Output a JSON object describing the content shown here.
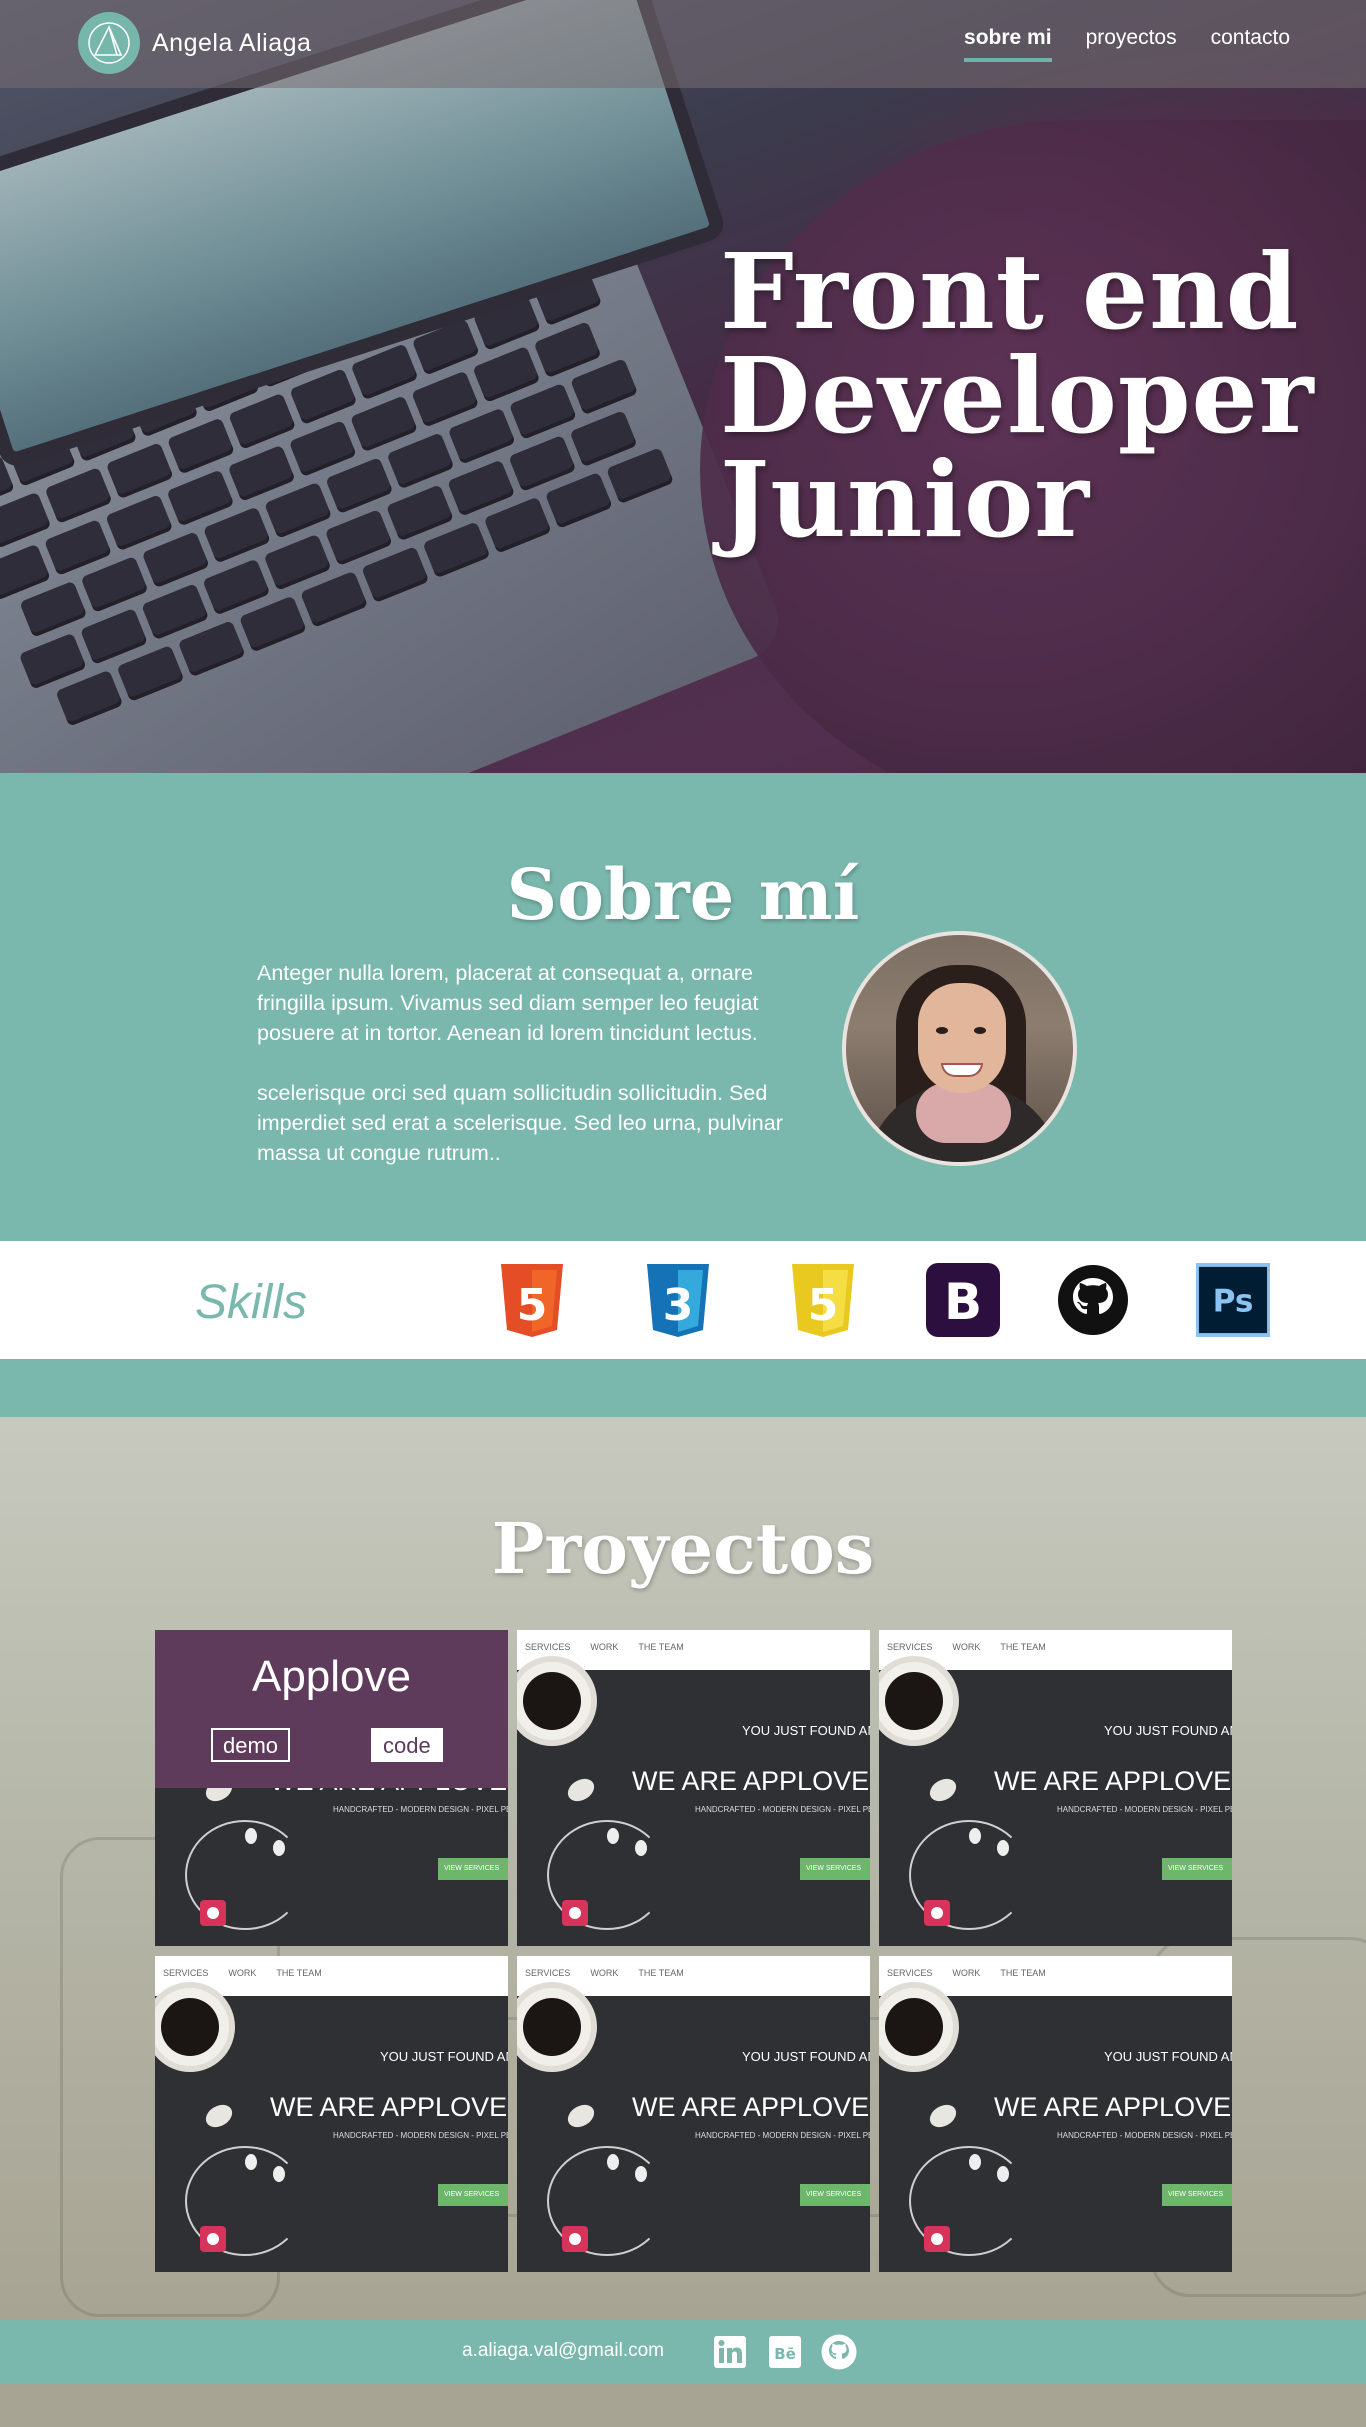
{
  "header": {
    "brand_name": "Angela Aliaga",
    "nav": [
      {
        "label": "sobre mi",
        "active": true
      },
      {
        "label": "proyectos",
        "active": false
      },
      {
        "label": "contacto",
        "active": false
      }
    ]
  },
  "hero": {
    "title_lines": [
      "Front end",
      "Developer",
      "Junior"
    ]
  },
  "about": {
    "title": "Sobre mí",
    "paragraph_1": "Anteger nulla lorem, placerat at consequat a, ornare fringilla ipsum. Vivamus sed diam semper leo feugiat posuere at in tortor. Aenean id lorem tincidunt lectus.",
    "paragraph_2": "scelerisque orci sed quam sollicitudin sollicitudin. Sed imperdiet sed erat a scelerisque. Sed leo urna, pulvinar massa ut congue rutrum..",
    "avatar_icon": "profile-photo"
  },
  "skills": {
    "title": "Skills",
    "items": [
      {
        "icon": "html5-icon",
        "label": "5",
        "color": "#e44d26"
      },
      {
        "icon": "css3-icon",
        "label": "3",
        "color": "#1572b6"
      },
      {
        "icon": "javascript-icon",
        "label": "5",
        "color": "#f0db4f"
      },
      {
        "icon": "bootstrap-icon",
        "label": "B",
        "color": "#2c0f3f"
      },
      {
        "icon": "github-icon",
        "label": "",
        "color": "#111111"
      },
      {
        "icon": "photoshop-icon",
        "label": "Ps",
        "color": "#001d34"
      }
    ]
  },
  "projects": {
    "title": "Proyectos",
    "thumb_nav": [
      "SERVICES",
      "WORK",
      "THE TEAM"
    ],
    "thumb_sub": "YOU JUST FOUND AN U",
    "thumb_headline": "WE ARE APPLOVE",
    "thumb_small": "HANDCRAFTED - MODERN DESIGN - PIXEL PE",
    "thumb_button": "VIEW SERVICES",
    "hover_card": {
      "title": "Applove",
      "demo_label": "demo",
      "code_label": "code"
    }
  },
  "footer": {
    "email": "a.aliaga.val@gmail.com",
    "icons": [
      "linkedin-icon",
      "behance-icon",
      "github-icon"
    ],
    "behance_text": "Bē"
  },
  "colors": {
    "teal": "#7ab8ad",
    "purple": "#5e3a5b",
    "white": "#ffffff"
  }
}
